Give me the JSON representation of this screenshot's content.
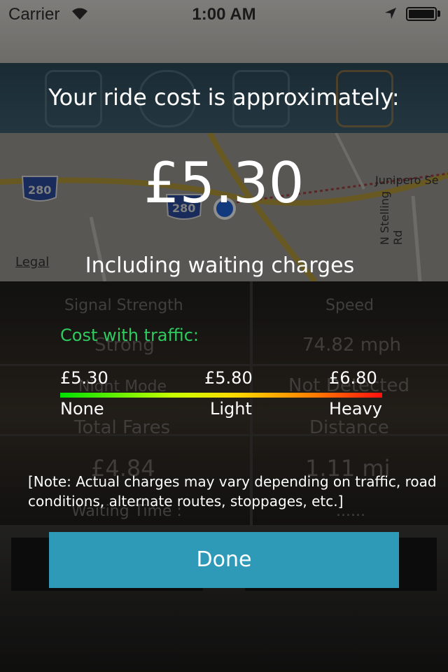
{
  "status_bar": {
    "carrier": "Carrier",
    "time": "1:00 AM",
    "icons": [
      "wifi-icon",
      "location-arrow-icon",
      "battery-icon"
    ]
  },
  "background_app": {
    "map": {
      "legal": "Legal",
      "highway_labels": [
        "280",
        "280"
      ],
      "street_labels": [
        "Junipero Se",
        "N Stelling Rd"
      ]
    },
    "stats": {
      "signal_strength_label": "Signal Strength",
      "signal_strength_value": "Strong",
      "speed_label": "Speed",
      "speed_value": "74.82 mph",
      "night_mode_label": "Night Mode",
      "night_mode_value": "Not Detected",
      "total_fares_label": "Total Fares",
      "total_fares_value": "£4.84",
      "distance_label": "Distance",
      "distance_value": "1.11 mi",
      "waiting_time_label": "Waiting Time :",
      "waiting_time_value": "......"
    }
  },
  "dialog": {
    "title": "Your ride cost is approximately:",
    "price": "£5.30",
    "subtitle": "Including waiting charges",
    "traffic_heading": "Cost with traffic:",
    "traffic_levels": [
      {
        "price": "£5.30",
        "label": "None"
      },
      {
        "price": "£5.80",
        "label": "Light"
      },
      {
        "price": "£6.80",
        "label": "Heavy"
      }
    ],
    "note": "[Note: Actual charges may vary depending on traffic, road conditions, alternate routes, stoppages, etc.]",
    "done_label": "Done"
  },
  "colors": {
    "accent_green": "#2ecc5e",
    "done_button": "#2e9ab8",
    "bar_gradient": [
      "#00e000",
      "#c8ff00",
      "#ffd700",
      "#ff8000",
      "#ff1010"
    ]
  }
}
